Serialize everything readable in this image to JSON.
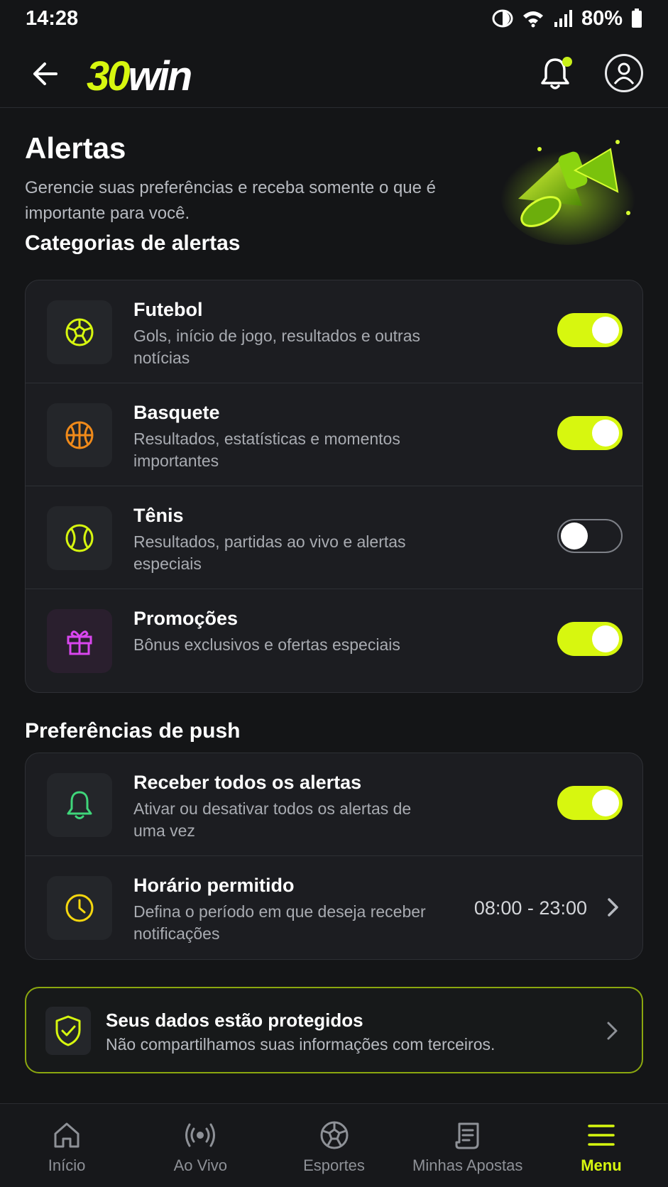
{
  "status": {
    "time": "14:28",
    "battery": "80%"
  },
  "brand": {
    "logo_num": "30",
    "logo_word": "win",
    "accent": "#d7f70f"
  },
  "header": {
    "title": "Alertas",
    "subtitle": "Gerencie suas preferências e receba somente o que é importante para você."
  },
  "categories": {
    "section_title": "Categorias de alertas",
    "items": [
      {
        "title": "Futebol",
        "desc": "Gols, início de jogo, resultados e outras notícias",
        "icon": "soccer-ball-icon",
        "enabled": true
      },
      {
        "title": "Basquete",
        "desc": "Resultados, estatísticas e momentos importantes",
        "icon": "basketball-icon",
        "enabled": true
      },
      {
        "title": "Tênis",
        "desc": "Resultados, partidas ao vivo e alertas especiais",
        "icon": "tennis-ball-icon",
        "enabled": false
      },
      {
        "title": "Promoções",
        "desc": "Bônus exclusivos e ofertas especiais",
        "icon": "gift-icon",
        "enabled": true
      }
    ]
  },
  "push": {
    "section_title": "Preferências de push",
    "all_alerts": {
      "title": "Receber todos os alertas",
      "desc": "Ativar ou desativar todos os alertas de uma vez",
      "icon": "bell-icon",
      "enabled": true
    },
    "schedule": {
      "title": "Horário permitido",
      "desc": "Defina o período em que deseja receber notificações",
      "icon": "clock-icon",
      "value": "08:00 - 23:00"
    }
  },
  "privacy": {
    "title": "Seus dados estão protegidos",
    "desc": "Não compartilhamos suas informações com terceiros.",
    "icon": "shield-check-icon"
  },
  "nav": {
    "items": [
      {
        "label": "Início",
        "icon": "home-icon",
        "active": false
      },
      {
        "label": "Ao Vivo",
        "icon": "live-icon",
        "active": false
      },
      {
        "label": "Esportes",
        "icon": "sports-ball-icon",
        "active": false
      },
      {
        "label": "Minhas Apostas",
        "icon": "bets-scroll-icon",
        "active": false
      },
      {
        "label": "Menu",
        "icon": "menu-icon",
        "active": true
      }
    ]
  }
}
